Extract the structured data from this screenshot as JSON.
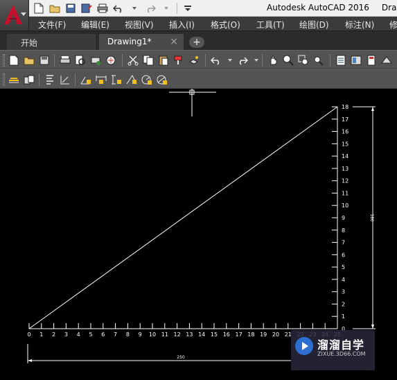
{
  "titlebar": {
    "app_title": "Autodesk AutoCAD 2016",
    "doc_title": "Draw"
  },
  "quick_access": [
    "new-icon",
    "open-icon",
    "save-icon",
    "save-as-icon",
    "print-icon",
    "undo-icon",
    "redo-icon",
    "customize-icon"
  ],
  "menubar": {
    "items": [
      {
        "label": "文件(F)"
      },
      {
        "label": "编辑(E)"
      },
      {
        "label": "视图(V)"
      },
      {
        "label": "插入(I)"
      },
      {
        "label": "格式(O)"
      },
      {
        "label": "工具(T)"
      },
      {
        "label": "绘图(D)"
      },
      {
        "label": "标注(N)"
      },
      {
        "label": "修"
      }
    ]
  },
  "tabs": {
    "start_label": "开始",
    "drawing_label": "Drawing1*",
    "close_glyph": "×",
    "add_glyph": "+"
  },
  "drawing": {
    "x_ticks": [
      "0",
      "1",
      "2",
      "3",
      "4",
      "5",
      "6",
      "7",
      "8",
      "9",
      "10",
      "11",
      "12",
      "13",
      "14",
      "15",
      "16",
      "17",
      "18",
      "19",
      "20",
      "21",
      "22",
      "23",
      "24",
      "25"
    ],
    "y_ticks": [
      "0",
      "1",
      "2",
      "3",
      "4",
      "5",
      "6",
      "7",
      "8",
      "9",
      "10",
      "11",
      "12",
      "13",
      "14",
      "15",
      "16",
      "17",
      "18"
    ],
    "dim_horizontal": "250",
    "dim_vertical": "180"
  },
  "watermark": {
    "title": "溜溜自学",
    "url": "ZIXUE.3D66.COM"
  },
  "colors": {
    "canvas": "#000000",
    "line": "#ffffff",
    "menubar": "#3b3b3b",
    "toolbar": "#535353",
    "app_button_accent": "#c8102e"
  }
}
